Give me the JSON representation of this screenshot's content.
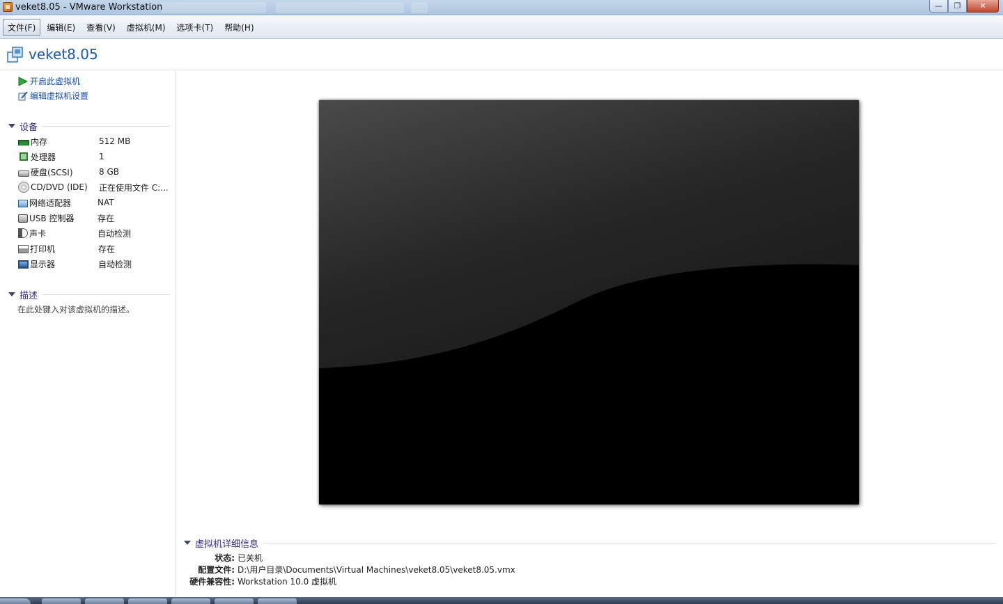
{
  "window": {
    "title": "veket8.05 - VMware Workstation",
    "controls": [
      "minimize-icon",
      "maximize-icon",
      "close-icon"
    ]
  },
  "menu": [
    {
      "label": "文件(F)"
    },
    {
      "label": "编辑(E)"
    },
    {
      "label": "查看(V)"
    },
    {
      "label": "虚拟机(M)"
    },
    {
      "label": "选项卡(T)"
    },
    {
      "label": "帮助(H)"
    }
  ],
  "header": {
    "vm_name": "veket8.05",
    "icon": "virtual-machine-icon"
  },
  "actions": {
    "power_on": "开启此虚拟机",
    "edit_settings": "编辑虚拟机设置"
  },
  "devices": {
    "title": "设备",
    "items": [
      {
        "name": "内存",
        "value": "512 MB",
        "icon": "memory-icon"
      },
      {
        "name": "处理器",
        "value": "1",
        "icon": "processor-icon"
      },
      {
        "name": "硬盘(SCSI)",
        "value": "8 GB",
        "icon": "hard-disk-icon"
      },
      {
        "name": "CD/DVD (IDE)",
        "value": "正在使用文件 C:...",
        "icon": "cd-dvd-icon"
      },
      {
        "name": "网络适配器",
        "value": "NAT",
        "icon": "network-adapter-icon"
      },
      {
        "name": "USB 控制器",
        "value": "存在",
        "icon": "usb-controller-icon"
      },
      {
        "name": "声卡",
        "value": "自动检测",
        "icon": "sound-card-icon"
      },
      {
        "name": "打印机",
        "value": "存在",
        "icon": "printer-icon"
      },
      {
        "name": "显示器",
        "value": "自动检测",
        "icon": "display-icon"
      }
    ]
  },
  "description": {
    "title": "描述",
    "placeholder": "在此处键入对该虚拟机的描述。"
  },
  "details": {
    "title": "虚拟机详细信息",
    "rows": [
      {
        "label": "状态:",
        "value": "已关机"
      },
      {
        "label": "配置文件:",
        "value": "D:\\用户目录\\Documents\\Virtual Machines\\veket8.05\\veket8.05.vmx"
      },
      {
        "label": "硬件兼容性:",
        "value": "Workstation 10.0 虚拟机"
      }
    ]
  },
  "colors": {
    "accent_link": "#1a4fa0",
    "vm_title": "#1c5aa5",
    "section_title": "#3a2a7a",
    "preview_background": "#000000"
  }
}
